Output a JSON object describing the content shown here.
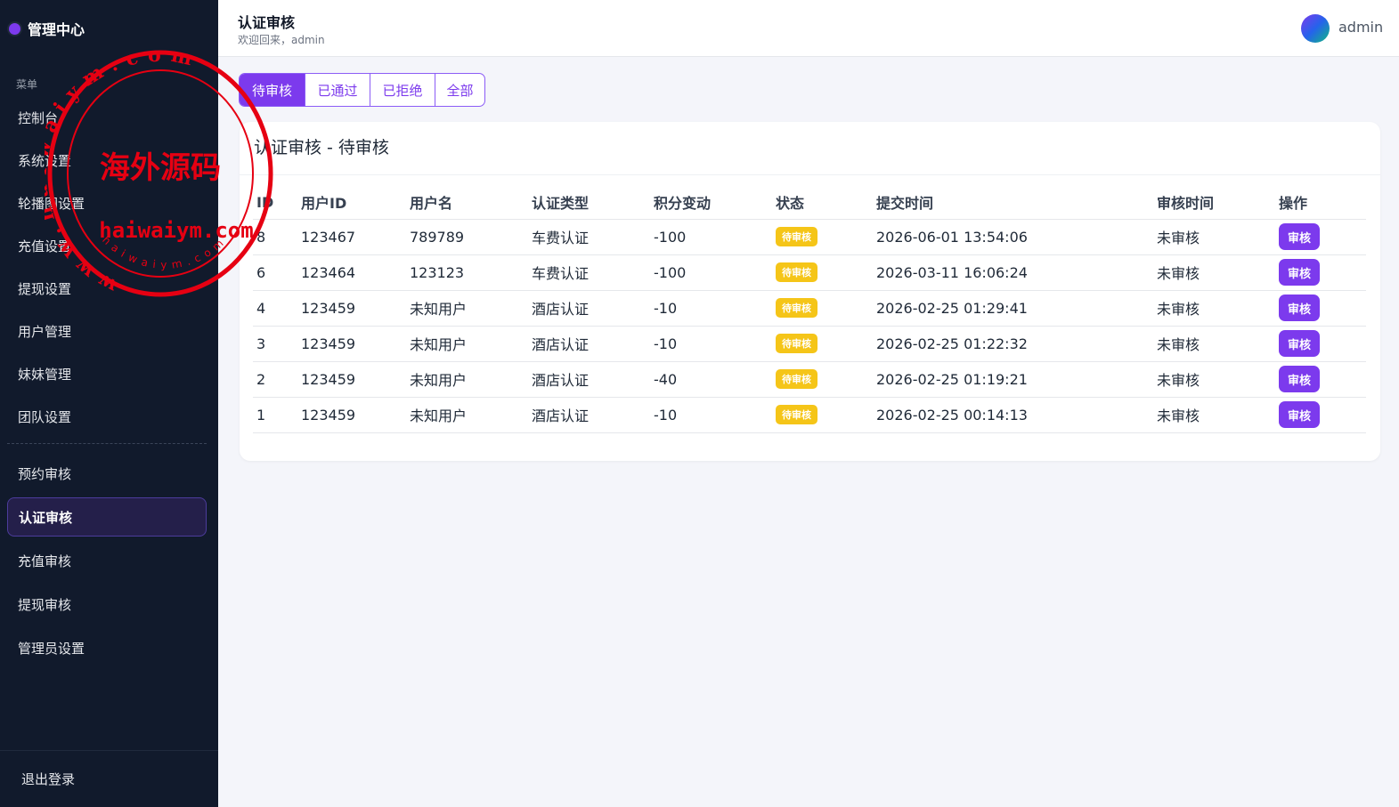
{
  "sidebar": {
    "brand": "管理中心",
    "caption": "菜单",
    "items_top": [
      {
        "label": "控制台",
        "name": "sidebar-item-dashboard"
      },
      {
        "label": "系统设置",
        "name": "sidebar-item-system-settings"
      },
      {
        "label": "轮播图设置",
        "name": "sidebar-item-carousel-settings"
      },
      {
        "label": "充值设置",
        "name": "sidebar-item-recharge-settings"
      },
      {
        "label": "提现设置",
        "name": "sidebar-item-withdraw-settings"
      },
      {
        "label": "用户管理",
        "name": "sidebar-item-user-management"
      },
      {
        "label": "妹妹管理",
        "name": "sidebar-item-girl-management"
      },
      {
        "label": "团队设置",
        "name": "sidebar-item-team-settings"
      }
    ],
    "items_bottom": [
      {
        "label": "预约审核",
        "name": "sidebar-item-booking-review"
      },
      {
        "label": "认证审核",
        "name": "sidebar-item-verification-review",
        "active": true
      },
      {
        "label": "充值审核",
        "name": "sidebar-item-recharge-review"
      },
      {
        "label": "提现审核",
        "name": "sidebar-item-withdraw-review"
      },
      {
        "label": "管理员设置",
        "name": "sidebar-item-admin-settings"
      }
    ],
    "logout": "退出登录"
  },
  "header": {
    "title": "认证审核",
    "subtitle": "欢迎回来，admin",
    "username": "admin"
  },
  "tabs": [
    {
      "label": "待审核",
      "active": true,
      "name": "tab-pending"
    },
    {
      "label": "已通过",
      "active": false,
      "name": "tab-approved"
    },
    {
      "label": "已拒绝",
      "active": false,
      "name": "tab-rejected"
    },
    {
      "label": "全部",
      "active": false,
      "name": "tab-all"
    }
  ],
  "card": {
    "title": "认证审核 - 待审核",
    "columns": [
      "ID",
      "用户ID",
      "用户名",
      "认证类型",
      "积分变动",
      "状态",
      "提交时间",
      "审核时间",
      "操作"
    ],
    "rows": [
      {
        "id": "8",
        "user_id": "123467",
        "username": "789789",
        "type": "车费认证",
        "points": "-100",
        "status": "待审核",
        "submitted": "2026-06-01 13:54:06",
        "reviewed": "未审核",
        "action": "审核"
      },
      {
        "id": "6",
        "user_id": "123464",
        "username": "123123",
        "type": "车费认证",
        "points": "-100",
        "status": "待审核",
        "submitted": "2026-03-11 16:06:24",
        "reviewed": "未审核",
        "action": "审核"
      },
      {
        "id": "4",
        "user_id": "123459",
        "username": "未知用户",
        "type": "酒店认证",
        "points": "-10",
        "status": "待审核",
        "submitted": "2026-02-25 01:29:41",
        "reviewed": "未审核",
        "action": "审核"
      },
      {
        "id": "3",
        "user_id": "123459",
        "username": "未知用户",
        "type": "酒店认证",
        "points": "-10",
        "status": "待审核",
        "submitted": "2026-02-25 01:22:32",
        "reviewed": "未审核",
        "action": "审核"
      },
      {
        "id": "2",
        "user_id": "123459",
        "username": "未知用户",
        "type": "酒店认证",
        "points": "-40",
        "status": "待审核",
        "submitted": "2026-02-25 01:19:21",
        "reviewed": "未审核",
        "action": "审核"
      },
      {
        "id": "1",
        "user_id": "123459",
        "username": "未知用户",
        "type": "酒店认证",
        "points": "-10",
        "status": "待审核",
        "submitted": "2026-02-25 00:14:13",
        "reviewed": "未审核",
        "action": "审核"
      }
    ]
  },
  "watermark": {
    "outer_text": "www.haiwaiym.com",
    "center_text": "海外源码",
    "domain_text": "haiwaiym.com",
    "inner_text": "haiwaiym.com",
    "color": "#e60012"
  },
  "colors": {
    "accent": "#7c3aed",
    "sidebar_bg": "#111a2c",
    "badge_pending": "#f5c518",
    "points_negative": "#dc2626"
  }
}
